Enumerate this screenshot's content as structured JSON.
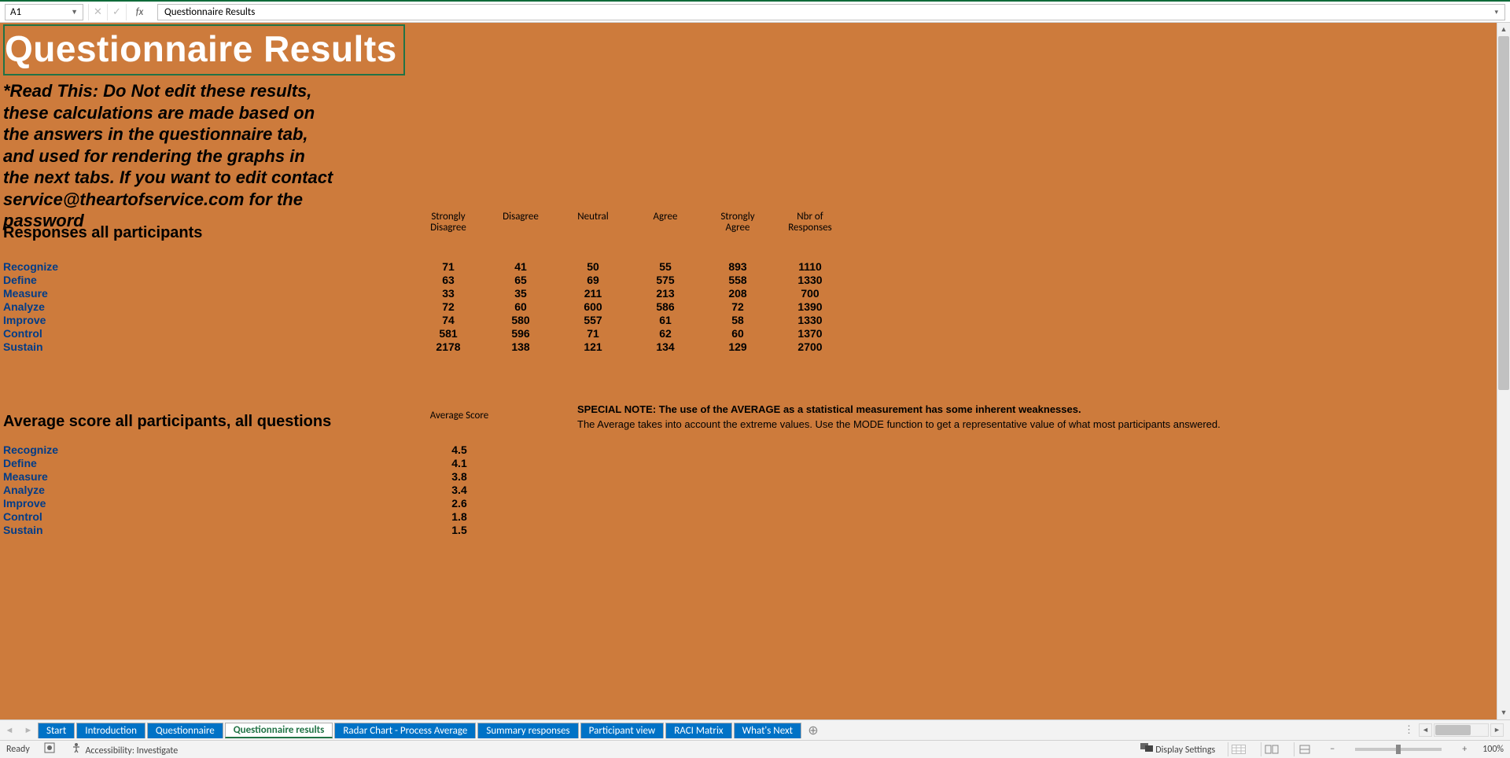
{
  "formula_bar": {
    "cell_ref": "A1",
    "cancel_glyph": "✕",
    "confirm_glyph": "✓",
    "fx_label": "fx",
    "value": "Questionnaire Results"
  },
  "sheet": {
    "title": "Questionnaire Results",
    "read_this": "*Read This: Do Not edit these results, these calculations are made based on the answers in the questionnaire tab, and used for rendering the graphs in the next tabs. If you want to edit contact service@theartofservice.com for the password",
    "responses": {
      "heading": "Responses all participants",
      "columns": [
        "Strongly Disagree",
        "Disagree",
        "Neutral",
        "Agree",
        "Strongly Agree",
        "Nbr of Responses"
      ],
      "rows": [
        {
          "label": "Recognize",
          "values": [
            "71",
            "41",
            "50",
            "55",
            "893",
            "1110"
          ]
        },
        {
          "label": "Define",
          "values": [
            "63",
            "65",
            "69",
            "575",
            "558",
            "1330"
          ]
        },
        {
          "label": "Measure",
          "values": [
            "33",
            "35",
            "211",
            "213",
            "208",
            "700"
          ]
        },
        {
          "label": "Analyze",
          "values": [
            "72",
            "60",
            "600",
            "586",
            "72",
            "1390"
          ]
        },
        {
          "label": "Improve",
          "values": [
            "74",
            "580",
            "557",
            "61",
            "58",
            "1330"
          ]
        },
        {
          "label": "Control",
          "values": [
            "581",
            "596",
            "71",
            "62",
            "60",
            "1370"
          ]
        },
        {
          "label": "Sustain",
          "values": [
            "2178",
            "138",
            "121",
            "134",
            "129",
            "2700"
          ]
        }
      ]
    },
    "averages": {
      "heading": "Average score all participants, all questions",
      "column": "Average Score",
      "rows": [
        {
          "label": "Recognize",
          "value": "4.5"
        },
        {
          "label": "Define",
          "value": "4.1"
        },
        {
          "label": "Measure",
          "value": "3.8"
        },
        {
          "label": "Analyze",
          "value": "3.4"
        },
        {
          "label": "Improve",
          "value": "2.6"
        },
        {
          "label": "Control",
          "value": "1.8"
        },
        {
          "label": "Sustain",
          "value": "1.5"
        }
      ],
      "note_bold": "SPECIAL NOTE: The use of the AVERAGE as a statistical measurement has some inherent weaknesses.",
      "note_reg": "The Average takes into account the extreme values. Use the MODE function to get a representative value of what most participants answered."
    }
  },
  "tabs": {
    "items": [
      "Start",
      "Introduction",
      "Questionnaire",
      "Questionnaire results",
      "Radar Chart - Process Average",
      "Summary responses",
      "Participant view",
      "RACI Matrix",
      "What's Next"
    ],
    "active_index": 3,
    "new_tab_glyph": "⊕"
  },
  "status_bar": {
    "ready": "Ready",
    "accessibility": "Accessibility: Investigate",
    "display_settings": "Display Settings",
    "zoom_pct": "100%"
  }
}
